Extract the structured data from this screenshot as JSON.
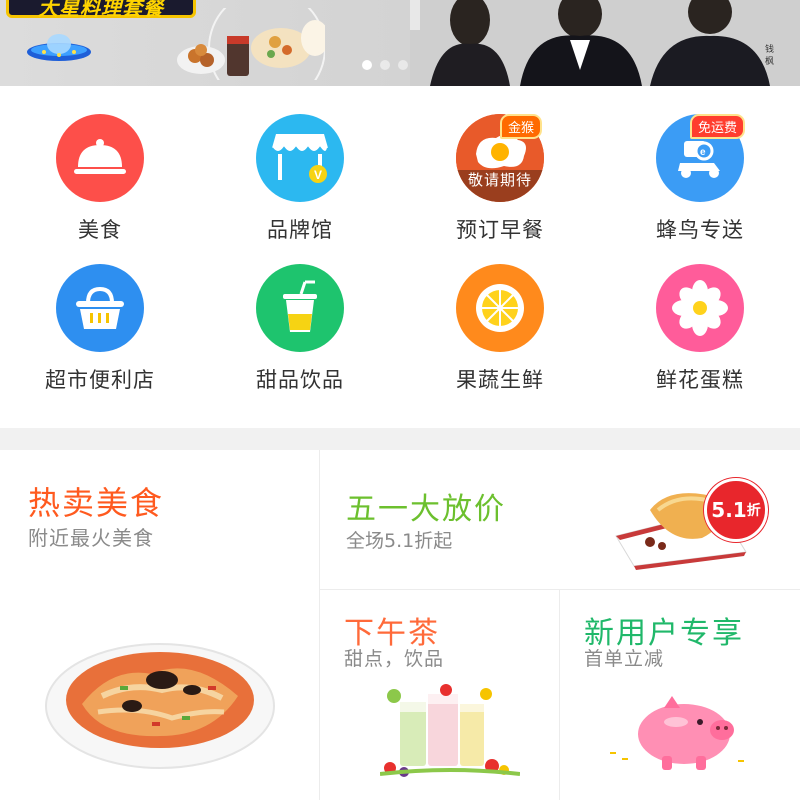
{
  "banner": {
    "headline": "大星料理套餐",
    "dots": 3,
    "active_dot": 0
  },
  "categories": [
    {
      "label": "美食",
      "color": "#fd4f4a",
      "icon": "cloche-icon"
    },
    {
      "label": "品牌馆",
      "color": "#2cb8f0",
      "icon": "storefront-icon"
    },
    {
      "label": "预订早餐",
      "color": "#e85a2a",
      "icon": "fried-egg-icon",
      "tag": "金猴",
      "overlay": "敬请期待"
    },
    {
      "label": "蜂鸟专送",
      "color": "#3b9cf5",
      "icon": "scooter-icon",
      "tag": "免运费"
    },
    {
      "label": "超市便利店",
      "color": "#2e8ff0",
      "icon": "basket-icon"
    },
    {
      "label": "甜品饮品",
      "color": "#1ec46e",
      "icon": "drink-cup-icon"
    },
    {
      "label": "果蔬生鲜",
      "color": "#ff8a1c",
      "icon": "lemon-slice-icon"
    },
    {
      "label": "鲜花蛋糕",
      "color": "#ff5c9a",
      "icon": "flower-icon"
    }
  ],
  "promos": {
    "hot": {
      "title": "热卖美食",
      "subtitle": "附近最火美食"
    },
    "wuyi": {
      "title": "五一大放价",
      "subtitle": "全场5.1折起",
      "badge_num": "5.1",
      "badge_unit": "折"
    },
    "tea": {
      "title": "下午茶",
      "subtitle": "甜点，饮品"
    },
    "new_user": {
      "title": "新用户专享",
      "subtitle": "首单立减"
    }
  }
}
